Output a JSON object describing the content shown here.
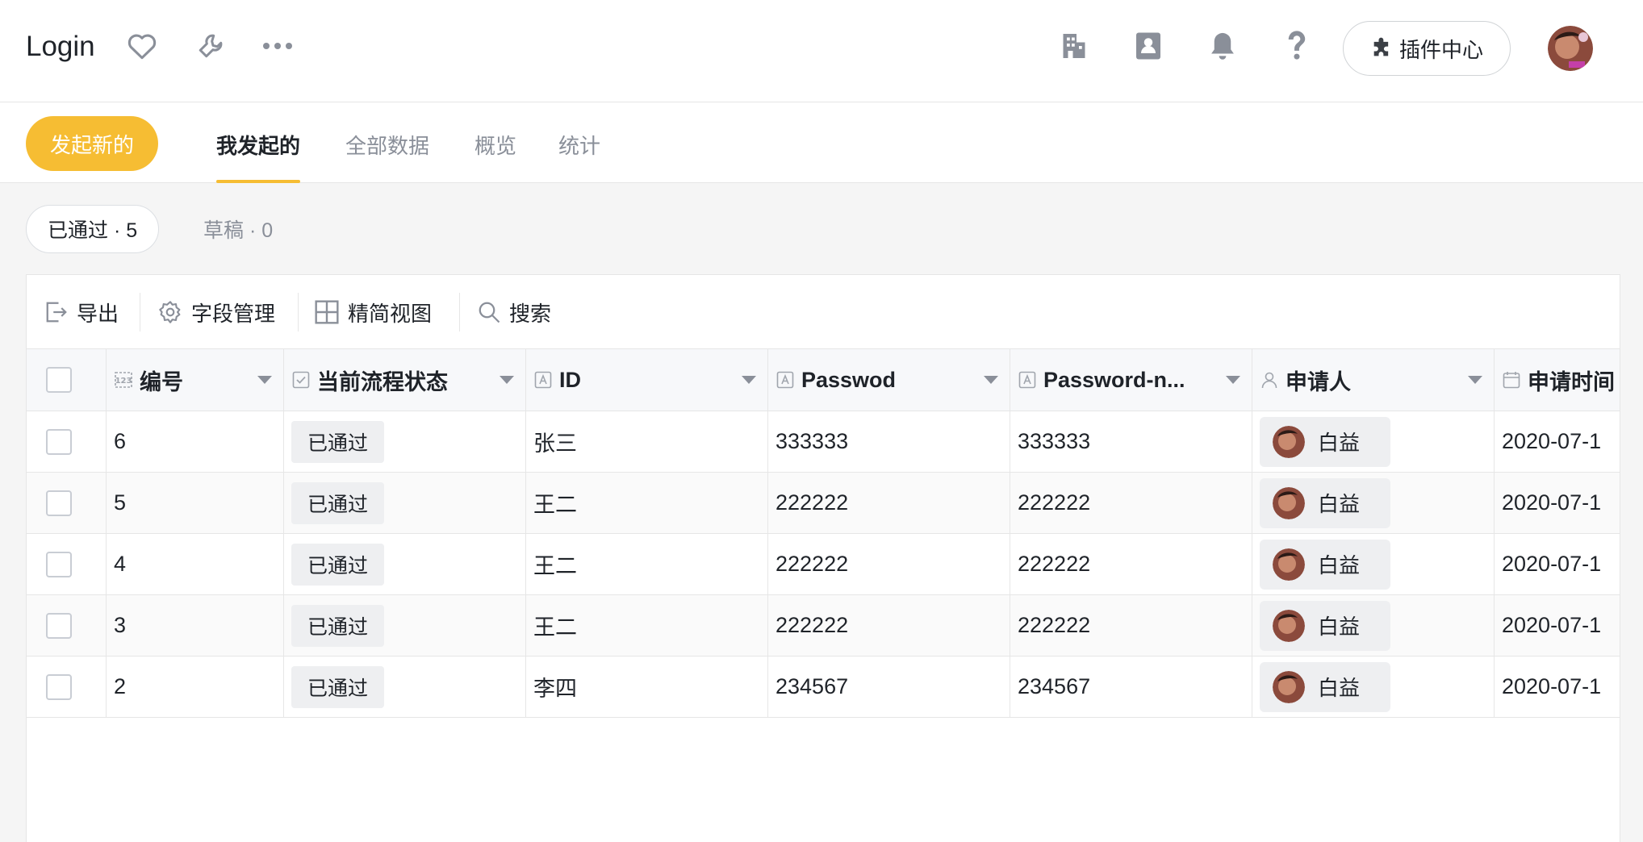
{
  "header": {
    "title": "Login",
    "icons": [
      "heart-icon",
      "wrench-icon",
      "more-icon",
      "building-icon",
      "contacts-icon",
      "bell-icon",
      "help-icon"
    ],
    "plugin_center": "插件中心"
  },
  "tabbar": {
    "start_button": "发起新的",
    "tabs": [
      {
        "label": "我发起的",
        "active": true
      },
      {
        "label": "全部数据",
        "active": false
      },
      {
        "label": "概览",
        "active": false
      },
      {
        "label": "统计",
        "active": false
      }
    ],
    "accent": "#f6bd33"
  },
  "filters": {
    "approved": "已通过 · 5",
    "draft": "草稿 · 0"
  },
  "toolbar": {
    "export": "导出",
    "fields": "字段管理",
    "compact_view": "精简视图",
    "search": "搜索"
  },
  "table": {
    "columns": [
      {
        "label": "编号",
        "icon": "number-field-icon"
      },
      {
        "label": "当前流程状态",
        "icon": "status-field-icon"
      },
      {
        "label": "ID",
        "icon": "text-field-icon"
      },
      {
        "label": "Passwod",
        "icon": "text-field-icon"
      },
      {
        "label": "Password-n...",
        "icon": "text-field-icon"
      },
      {
        "label": "申请人",
        "icon": "user-field-icon"
      },
      {
        "label": "申请时间",
        "icon": "calendar-field-icon"
      }
    ],
    "rows": [
      {
        "num": "6",
        "status": "已通过",
        "id": "张三",
        "passwod": "333333",
        "password_n": "333333",
        "applicant": "白益",
        "time": "2020-07-1"
      },
      {
        "num": "5",
        "status": "已通过",
        "id": "王二",
        "passwod": "222222",
        "password_n": "222222",
        "applicant": "白益",
        "time": "2020-07-1"
      },
      {
        "num": "4",
        "status": "已通过",
        "id": "王二",
        "passwod": "222222",
        "password_n": "222222",
        "applicant": "白益",
        "time": "2020-07-1"
      },
      {
        "num": "3",
        "status": "已通过",
        "id": "王二",
        "passwod": "222222",
        "password_n": "222222",
        "applicant": "白益",
        "time": "2020-07-1"
      },
      {
        "num": "2",
        "status": "已通过",
        "id": "李四",
        "passwod": "234567",
        "password_n": "234567",
        "applicant": "白益",
        "time": "2020-07-1"
      }
    ]
  }
}
